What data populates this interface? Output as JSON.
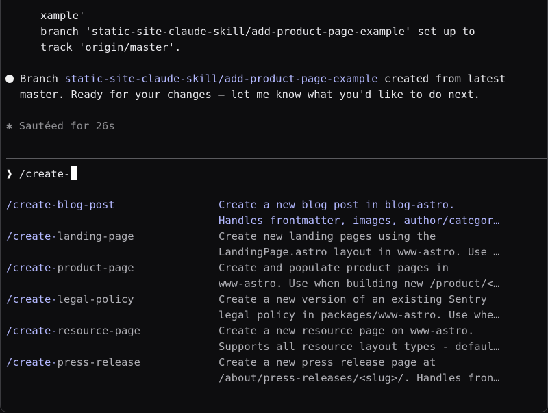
{
  "output": {
    "line1": "xample'",
    "line2": "branch 'static-site-claude-skill/add-product-page-example' set up to",
    "line3": "track 'origin/master'."
  },
  "message": {
    "prefix": "Branch ",
    "branch": "static-site-claude-skill/add-product-page-example",
    "suffix": " created from latest",
    "line2": "master. Ready for your changes — let me know what you'd like to do next."
  },
  "status": {
    "icon": "asterisk-icon",
    "glyph": "✱",
    "text": "Sautéed for 26s"
  },
  "prompt": {
    "arrow": "❱",
    "input_value": "/create-"
  },
  "suggestions": {
    "match_prefix": "/create-",
    "items": [
      {
        "rest": "blog-post",
        "desc1": "Create a new blog post in blog-astro.",
        "desc2": "Handles frontmatter, images, author/categor…",
        "selected": true
      },
      {
        "rest": "landing-page",
        "desc1": "Create new landing pages using the",
        "desc2": "LandingPage.astro layout in www-astro. Use …",
        "selected": false
      },
      {
        "rest": "product-page",
        "desc1": "Create and populate product pages in",
        "desc2": "www-astro. Use when building new /product/<…",
        "selected": false
      },
      {
        "rest": "legal-policy",
        "desc1": "Create a new version of an existing Sentry",
        "desc2": "legal policy in packages/www-astro. Use whe…",
        "selected": false
      },
      {
        "rest": "resource-page",
        "desc1": "Create a new resource page on www-astro.",
        "desc2": "Supports all resource layout types - defaul…",
        "selected": false
      },
      {
        "rest": "press-release",
        "desc1": "Create a new press release page at",
        "desc2": "/about/press-releases/<slug>/. Handles fron…",
        "selected": false
      }
    ]
  }
}
